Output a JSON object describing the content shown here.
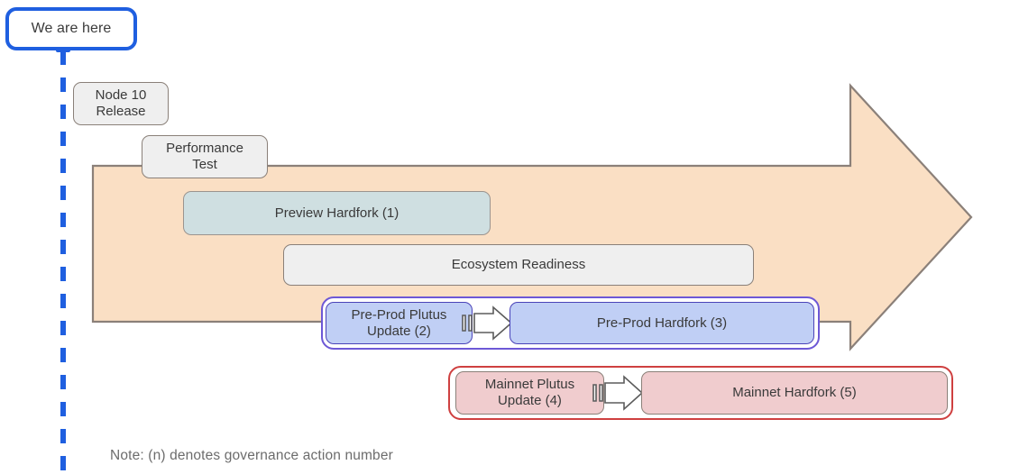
{
  "diagram": {
    "callout": {
      "label": "We are here"
    },
    "note": "Note: (n) denotes governance action number",
    "colors": {
      "timeline_arrow_fill": "#fadfc4",
      "timeline_arrow_stroke": "#8b8079",
      "now_line": "#1f5fe0",
      "callout_border": "#1f5fe0",
      "grey_box": "#efefef",
      "teal_box": "#cfdfe1",
      "blue_box": "#c0cff5",
      "blue_group_border": "#6d58d6",
      "pink_box": "#f0ccce",
      "red_group_border": "#cf4040",
      "box_border": "#8b8079",
      "text": "#3a3a3a",
      "note_text": "#6c6c6c"
    },
    "milestones": [
      {
        "id": "node-10-release",
        "label": "Node 10\nRelease",
        "style": "grey"
      },
      {
        "id": "performance-test",
        "label": "Performance\nTest",
        "style": "grey"
      },
      {
        "id": "preview-hardfork",
        "label": "Preview Hardfork (1)",
        "style": "teal",
        "governance_action": 1
      },
      {
        "id": "ecosystem-readiness",
        "label": "Ecosystem Readiness",
        "style": "grey"
      },
      {
        "id": "pre-prod-plutus-update",
        "label": "Pre-Prod Plutus\nUpdate (2)",
        "style": "blue",
        "governance_action": 2
      },
      {
        "id": "pre-prod-hardfork",
        "label": "Pre-Prod Hardfork (3)",
        "style": "blue",
        "governance_action": 3
      },
      {
        "id": "mainnet-plutus-update",
        "label": "Mainnet Plutus\nUpdate (4)",
        "style": "pink",
        "governance_action": 4
      },
      {
        "id": "mainnet-hardfork",
        "label": "Mainnet Hardfork (5)",
        "style": "pink",
        "governance_action": 5
      }
    ],
    "groups": [
      {
        "id": "pre-prod-group",
        "style": "purple",
        "contains": [
          "pre-prod-plutus-update",
          "pre-prod-hardfork"
        ]
      },
      {
        "id": "mainnet-group",
        "style": "red",
        "contains": [
          "mainnet-plutus-update",
          "mainnet-hardfork"
        ]
      }
    ]
  }
}
